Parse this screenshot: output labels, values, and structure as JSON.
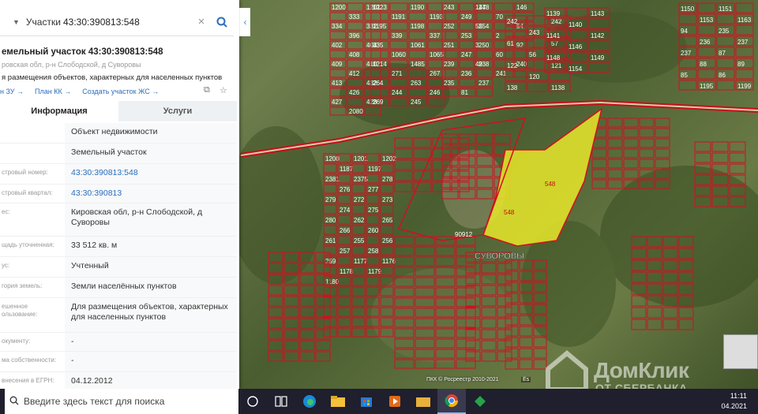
{
  "search": {
    "category": "Участки",
    "value": "43:30:390813:548"
  },
  "parcel": {
    "title": "емельный участок 43:30:390813:548",
    "address": "ровская обл, р-н Слободской, д Суворовы",
    "purpose": "я размещения объектов, характерных для населенных пунктов"
  },
  "links": [
    "н ЗУ →",
    "План КК →",
    "Создать участок ЖС →"
  ],
  "tabs": [
    "Информация",
    "Услуги"
  ],
  "rows": [
    {
      "label": "",
      "value": "Объект недвижимости"
    },
    {
      "label": "",
      "value": "Земельный участок"
    },
    {
      "label": "стровый номер:",
      "value": "43:30:390813:548",
      "link": true
    },
    {
      "label": "стровый квартал:",
      "value": "43:30:390813",
      "link": true
    },
    {
      "label": "ес:",
      "value": "Кировская обл, р-н Слободской, д Суворовы"
    },
    {
      "label": "щадь уточненная:",
      "value": "33 512 кв. м"
    },
    {
      "label": "ус:",
      "value": "Учтенный"
    },
    {
      "label": "гория земель:",
      "value": "Земли населённых пунктов"
    },
    {
      "label": "ешенное ользование:",
      "value": "Для размещения объектов, характерных для населенных пунктов"
    },
    {
      "label": "окументу:",
      "value": "-"
    },
    {
      "label": "ма собственности:",
      "value": "-"
    },
    {
      "label": "внесения в ЕГРН:",
      "value": "04.12.2012"
    }
  ],
  "map": {
    "village_label": "СУВОРОВЫ",
    "selected_labels": [
      "548",
      "548"
    ],
    "quarter_label": "90912",
    "plots": [
      "1200",
      "1201",
      "333",
      "334",
      "332",
      "396",
      "402",
      "404",
      "408",
      "409",
      "410",
      "412",
      "413",
      "432",
      "426",
      "427",
      "428",
      "2080",
      "1223",
      "1190",
      "1191",
      "1193",
      "1195",
      "1198",
      "339",
      "337",
      "335",
      "1061",
      "1060",
      "1065",
      "1214",
      "1485",
      "271",
      "267",
      "264",
      "263",
      "244",
      "246",
      "269",
      "245",
      "243",
      "248",
      "249",
      "252",
      "254",
      "253",
      "251",
      "250",
      "247",
      "239",
      "238",
      "236",
      "235",
      "237",
      "81",
      "147",
      "146",
      "70",
      "55",
      "54",
      "2",
      "3",
      "92",
      "60",
      "49",
      "240",
      "241",
      "242",
      "242",
      "243",
      "61",
      "57",
      "56",
      "122",
      "121",
      "120",
      "138",
      "1138",
      "1139",
      "1143",
      "1140",
      "1141",
      "1142",
      "1146",
      "1148",
      "1149",
      "1154",
      "1150",
      "1151",
      "1153",
      "1163",
      "94",
      "235",
      "236",
      "237",
      "237",
      "87",
      "88",
      "89",
      "85",
      "86",
      "1195",
      "1199",
      "1200",
      "1201",
      "1202",
      "1187",
      "1197",
      "2381",
      "2375",
      "278",
      "276",
      "277",
      "279",
      "272",
      "273",
      "274",
      "275",
      "280",
      "262",
      "265",
      "266",
      "260",
      "261",
      "255",
      "256",
      "257",
      "258",
      "259",
      "1177",
      "1176",
      "1178",
      "1179",
      "1180"
    ],
    "attribution": "ПКК © Росреестр 2010-2021",
    "es_tag": "Es"
  },
  "watermark": {
    "brand": "ДомКлик",
    "sub": "ОТ СБЕРБАНКА"
  },
  "taskbar": {
    "search_placeholder": "Введите здесь текст для поиска",
    "time": "11:11",
    "date": "04.2021"
  },
  "colors": {
    "boundary": "#d01020",
    "selected_fill": "#e7e72a",
    "link": "#2a6ebd",
    "road": "#c0121c"
  }
}
